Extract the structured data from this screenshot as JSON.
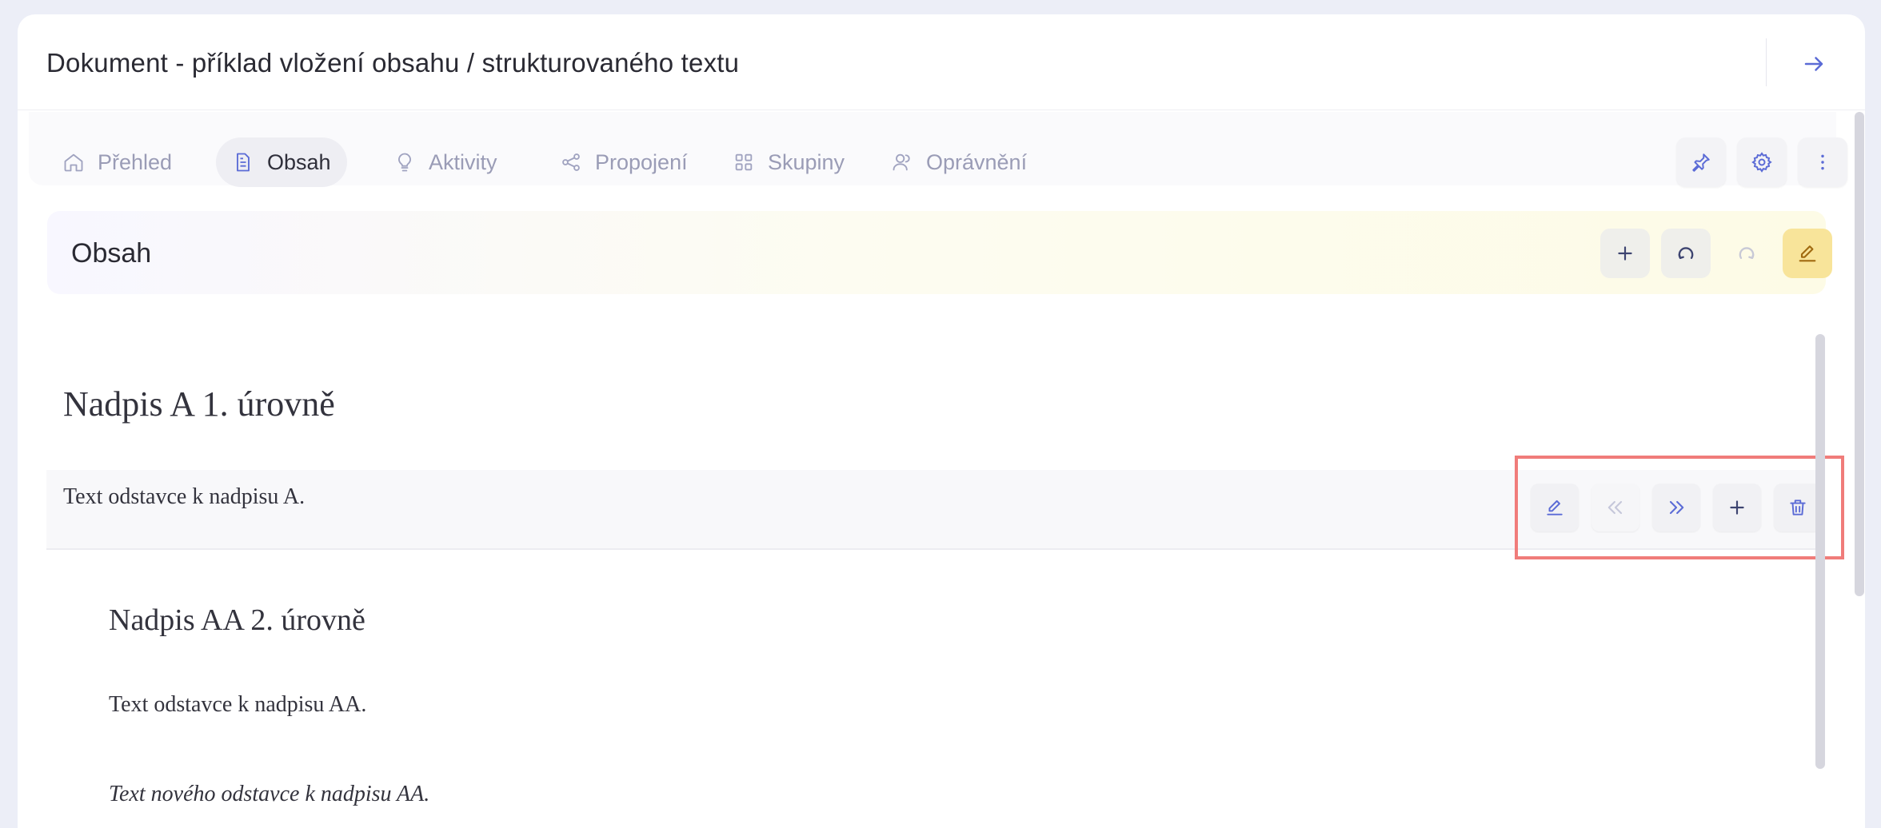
{
  "header": {
    "title": "Dokument - příklad vložení obsahu / strukturovaného textu",
    "action_icon": "arrow-right-icon"
  },
  "tabs": [
    {
      "label": "Přehled",
      "icon": "home-icon",
      "active": false
    },
    {
      "label": "Obsah",
      "icon": "document-icon",
      "active": true
    },
    {
      "label": "Aktivity",
      "icon": "lightbulb-icon",
      "active": false
    },
    {
      "label": "Propojení",
      "icon": "share-icon",
      "active": false
    },
    {
      "label": "Skupiny",
      "icon": "grid-icon",
      "active": false
    },
    {
      "label": "Oprávnění",
      "icon": "users-icon",
      "active": false
    }
  ],
  "tools": [
    "pin-icon",
    "gear-icon",
    "more-vertical-icon"
  ],
  "section": {
    "title": "Obsah",
    "actions": [
      "plus-icon",
      "undo-icon",
      "redo-icon",
      "pencil-icon"
    ]
  },
  "content": {
    "heading1": "Nadpis A 1. úrovně",
    "paragraph1": "Text odstavce k nadpisu A.",
    "row_actions": [
      "pencil-icon",
      "chevrons-left-icon",
      "chevrons-right-icon",
      "plus-icon",
      "trash-icon"
    ],
    "heading2": "Nadpis AA 2. úrovně",
    "paragraph2": "Text odstavce k nadpisu AA.",
    "paragraph3": "Text nového odstavce k nadpisu AA."
  },
  "colors": {
    "accent": "#5b6bd6",
    "highlight_border": "#f07c7a",
    "edit_button": "#f8e49a"
  }
}
